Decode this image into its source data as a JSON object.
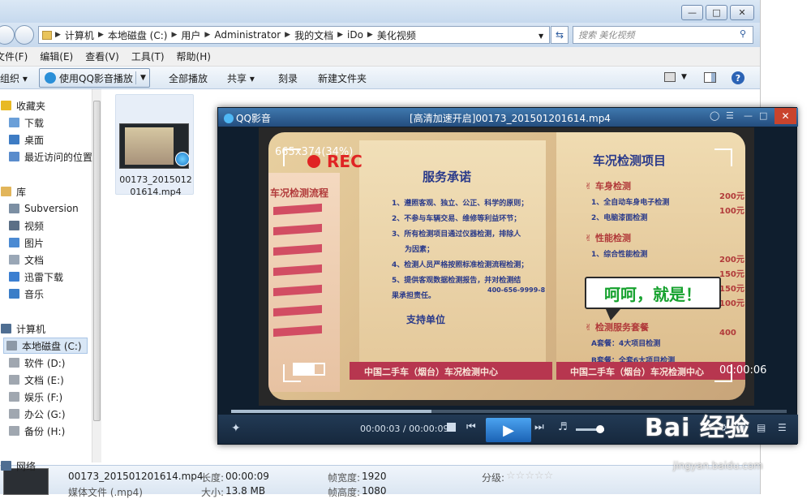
{
  "explorer": {
    "address": [
      "计算机",
      "本地磁盘 (C:)",
      "用户",
      "Administrator",
      "我的文档",
      "iDo",
      "美化视频"
    ],
    "search_placeholder": "搜索 美化视频",
    "menu": [
      "文件(F)",
      "编辑(E)",
      "查看(V)",
      "工具(T)",
      "帮助(H)"
    ],
    "toolbar": {
      "organize": "组织",
      "qq_play": "使用QQ影音播放",
      "play_all": "全部播放",
      "share": "共享",
      "burn": "刻录",
      "new_folder": "新建文件夹"
    },
    "sidebar": [
      {
        "label": "收藏夹",
        "color": "#e8b923"
      },
      {
        "label": "下载",
        "color": "#6a9fd8"
      },
      {
        "label": "桌面",
        "color": "#3e7cc4"
      },
      {
        "label": "最近访问的位置",
        "color": "#5a8ccc"
      },
      {
        "label": "库",
        "color": "#e2b55a"
      },
      {
        "label": "Subversion",
        "color": "#7c8fa3"
      },
      {
        "label": "视频",
        "color": "#5b6f86"
      },
      {
        "label": "图片",
        "color": "#4b8ad2"
      },
      {
        "label": "文档",
        "color": "#9aa7b6"
      },
      {
        "label": "迅雷下载",
        "color": "#3c7fd1"
      },
      {
        "label": "音乐",
        "color": "#3b7ec8"
      },
      {
        "label": "计算机",
        "color": "#4f6e92"
      },
      {
        "label": "本地磁盘 (C:)",
        "color": "#8d99a7"
      },
      {
        "label": "软件 (D:)",
        "color": "#a0a7b0"
      },
      {
        "label": "文档 (E:)",
        "color": "#a0a7b0"
      },
      {
        "label": "娱乐 (F:)",
        "color": "#a0a7b0"
      },
      {
        "label": "办公 (G:)",
        "color": "#a0a7b0"
      },
      {
        "label": "备份 (H:)",
        "color": "#a0a7b0"
      },
      {
        "label": "网络",
        "color": "#4f6e92"
      }
    ],
    "file": {
      "name": "00173_201501201614.mp4"
    },
    "status": {
      "filename": "00173_201501201614.mp4",
      "type": "媒体文件 (.mp4)",
      "duration_label": "长度:",
      "duration": "00:00:09",
      "size_label": "大小:",
      "size": "13.8 MB",
      "width_label": "帧宽度:",
      "width": "1920",
      "height_label": "帧高度:",
      "height": "1080",
      "rating_label": "分级:",
      "rating": 0
    }
  },
  "player": {
    "brand": "QQ影音",
    "title": "[高清加速开启]00173_201501201614.mp4",
    "resolution": "665x374(34%)",
    "rec": "REC",
    "osd_time": "00:00:06",
    "bubble": "呵呵，就是！",
    "time": "00:00:03 / 00:00:09",
    "progress": 0.36,
    "volume": 0.85,
    "video": {
      "left_title": "车况检测流程",
      "center_title": "服务承诺",
      "right_title": "车况检测项目",
      "promises": [
        "1、遵照客观、独立、公正、科学的原则；",
        "2、不参与车辆交易、维修等利益环节；",
        "3、所有检测项目通过仪器检测，排除人",
        "为因素；",
        "4、检测人员严格按照标准检测流程检测；",
        "5、提供客观数据检测报告，并对检测结",
        "果承担责任。"
      ],
      "support": "支持单位",
      "right_items": [
        "车身检测",
        "1、全自动车身电子检测",
        "2、电脑漆面检测",
        "性能检测",
        "1、综合性能检测",
        "检测服务套餐",
        "A套餐：4大项目检测",
        "B套餐：全套6大项目检测"
      ],
      "right_prices": [
        "200元",
        "100元",
        "200元",
        "150元",
        "150元",
        "100元",
        "400"
      ],
      "bottom_left": "中国二手车（烟台）车况检测中心",
      "bottom_right": "中国二手车（烟台）车况检测中心",
      "hotline": "400-656-9999-8"
    }
  },
  "watermark": {
    "brand": "Bai 经验",
    "url": "jingyan.baidu.com"
  }
}
